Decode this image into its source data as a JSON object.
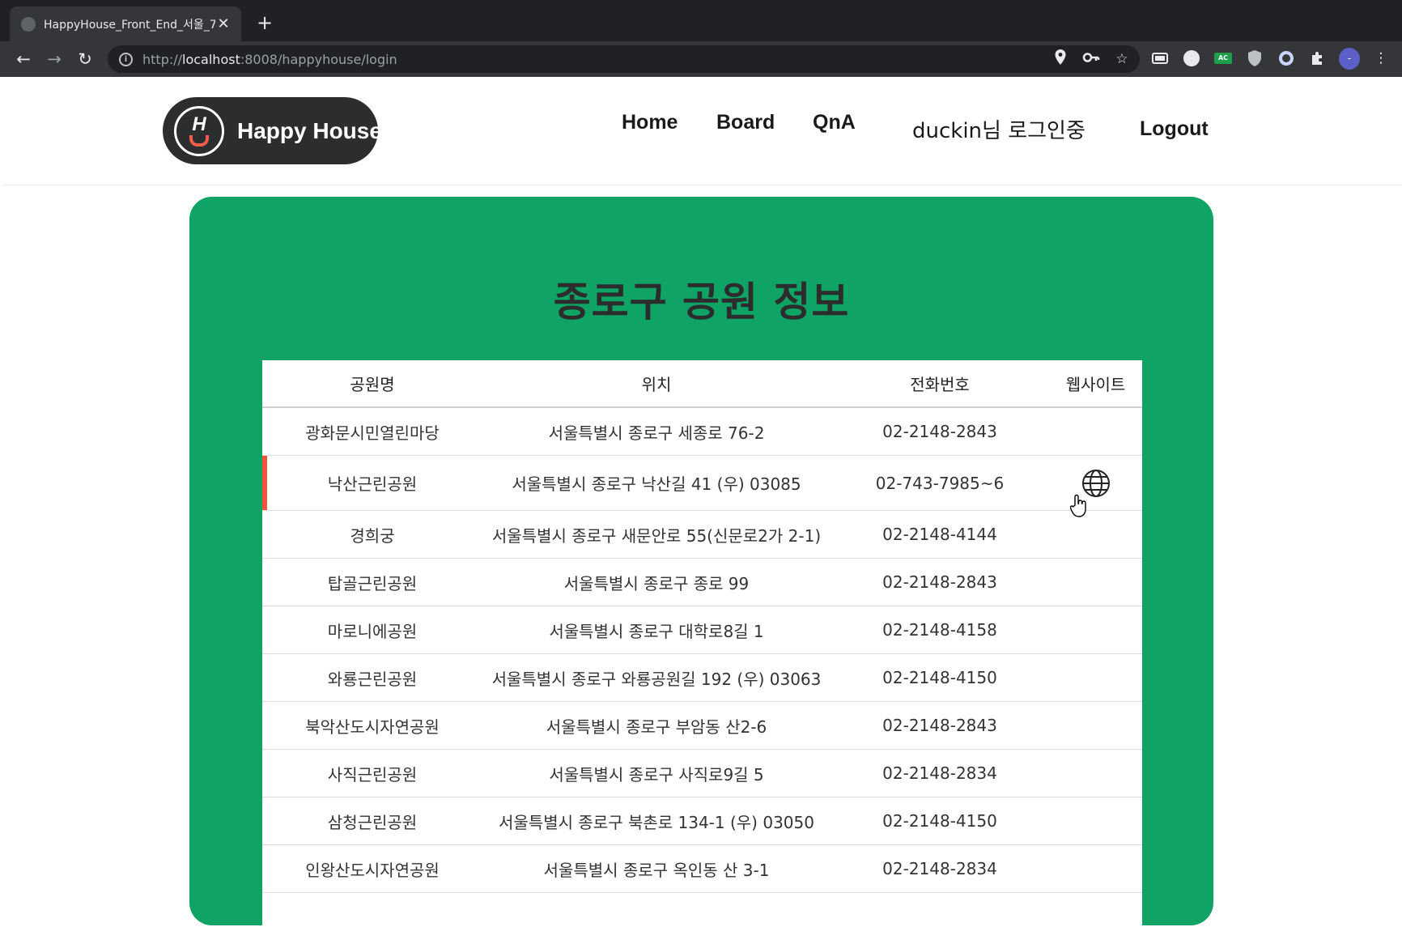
{
  "browser": {
    "tab_title": "HappyHouse_Front_End_서울_7",
    "tab_close": "✕",
    "new_tab": "+",
    "url_scheme": "http://",
    "url_host": "localhost",
    "url_rest": ":8008/happyhouse/login",
    "profile_initial": "-",
    "ext_ac_label": "AC"
  },
  "header": {
    "logo_text": "Happy House",
    "logo_letter": "H",
    "nav": [
      "Home",
      "Board",
      "QnA"
    ],
    "login_status": "duckin님 로그인중",
    "logout_label": "Logout"
  },
  "card": {
    "title": "종로구 공원 정보"
  },
  "table": {
    "columns": [
      "공원명",
      "위치",
      "전화번호",
      "웹사이트"
    ],
    "rows": [
      {
        "name": "광화문시민열린마당",
        "location": "서울특별시 종로구 세종로 76-2",
        "phone": "02-2148-2843",
        "has_website": false
      },
      {
        "name": "낙산근린공원",
        "location": "서울특별시 종로구 낙산길 41 (우) 03085",
        "phone": "02-743-7985~6",
        "has_website": true
      },
      {
        "name": "경희궁",
        "location": "서울특별시 종로구 새문안로 55(신문로2가 2-1)",
        "phone": "02-2148-4144",
        "has_website": false
      },
      {
        "name": "탑골근린공원",
        "location": "서울특별시 종로구 종로 99",
        "phone": "02-2148-2843",
        "has_website": false
      },
      {
        "name": "마로니에공원",
        "location": "서울특별시 종로구 대학로8길 1",
        "phone": "02-2148-4158",
        "has_website": false
      },
      {
        "name": "와룡근린공원",
        "location": "서울특별시 종로구 와룡공원길 192 (우) 03063",
        "phone": "02-2148-4150",
        "has_website": false
      },
      {
        "name": "북악산도시자연공원",
        "location": "서울특별시 종로구 부암동 산2-6",
        "phone": "02-2148-2843",
        "has_website": false
      },
      {
        "name": "사직근린공원",
        "location": "서울특별시 종로구 사직로9길 5",
        "phone": "02-2148-2834",
        "has_website": false
      },
      {
        "name": "삼청근린공원",
        "location": "서울특별시 종로구 북촌로 134-1 (우) 03050",
        "phone": "02-2148-4150",
        "has_website": false
      },
      {
        "name": "인왕산도시자연공원",
        "location": "서울특별시 종로구 옥인동 산 3-1",
        "phone": "02-2148-2834",
        "has_website": false
      }
    ]
  },
  "colors": {
    "card_green": "#0fa365",
    "highlight_red": "#f0523e",
    "logo_dark": "#2b2d2e"
  }
}
